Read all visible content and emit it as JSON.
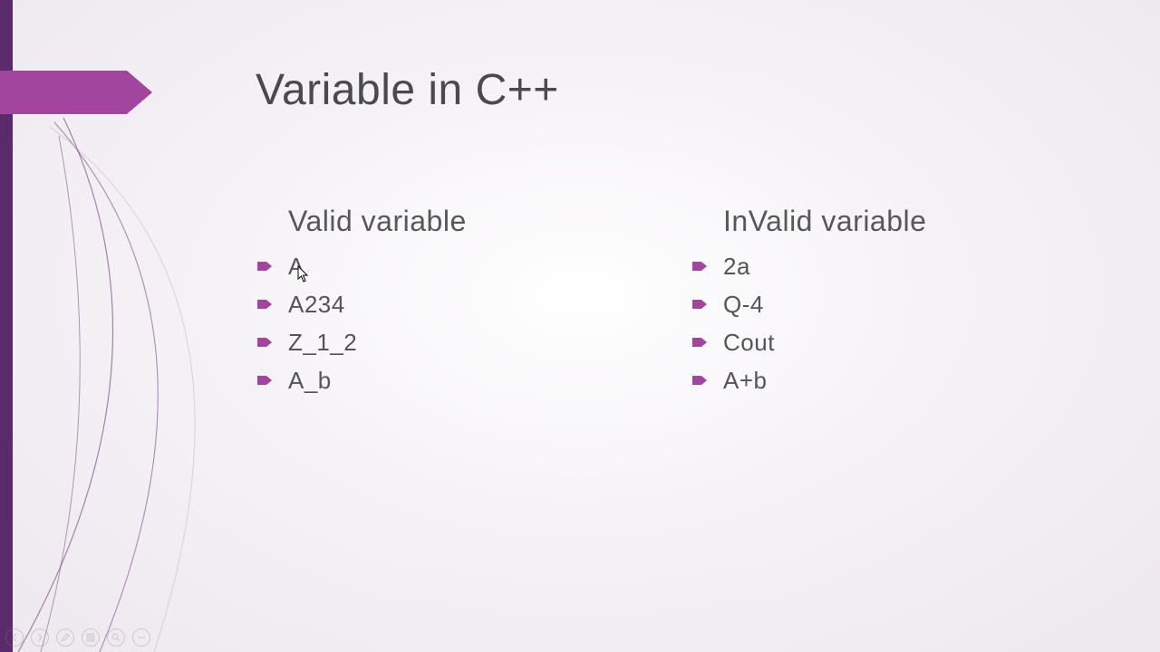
{
  "title": "Variable in C++",
  "columns": {
    "valid": {
      "heading": "Valid variable",
      "items": [
        "A",
        "A234",
        "Z_1_2",
        "A_b"
      ]
    },
    "invalid": {
      "heading": "InValid variable",
      "items": [
        "2a",
        "Q-4",
        "Cout",
        "A+b"
      ]
    }
  },
  "colors": {
    "accent": "#a1459f",
    "left_bar": "#5a2a6a"
  },
  "controls": {
    "prev": "prev",
    "next": "next",
    "pen": "pen",
    "see_all": "see-all",
    "zoom": "zoom",
    "more": "more"
  }
}
